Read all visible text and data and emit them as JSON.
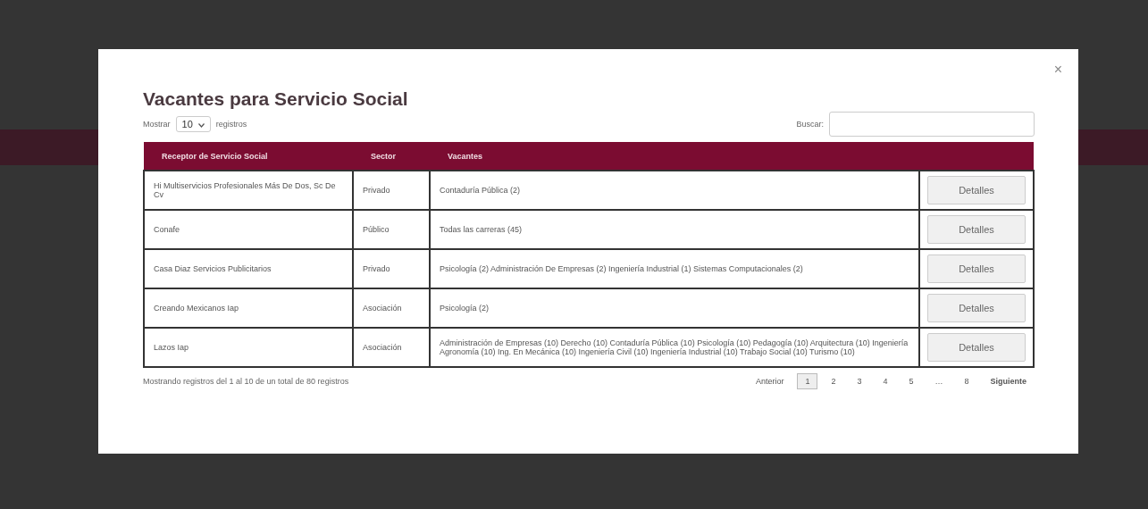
{
  "modal": {
    "title": "Vacantes para Servicio Social",
    "close": "×",
    "length": {
      "prefix": "Mostrar",
      "value": "10",
      "suffix": "registros"
    },
    "search": {
      "label": "Buscar:"
    },
    "table": {
      "columns": [
        "Receptor de Servicio Social",
        "Sector",
        "Vacantes"
      ],
      "rows": [
        {
          "receptor": "Hi Multiservicios Profesionales Más De Dos, Sc De Cv",
          "sector": "Privado",
          "vacantes": "Contaduría Pública (2)",
          "action": "Detalles"
        },
        {
          "receptor": "Conafe",
          "sector": "Público",
          "vacantes": "Todas las carreras (45)",
          "action": "Detalles"
        },
        {
          "receptor": "Casa Diaz Servicios Publicitarios",
          "sector": "Privado",
          "vacantes": "Psicología (2) Administración De Empresas (2) Ingeniería Industrial (1) Sistemas Computacionales (2)",
          "action": "Detalles"
        },
        {
          "receptor": "Creando Mexicanos Iap",
          "sector": "Asociación",
          "vacantes": "Psicología (2)",
          "action": "Detalles"
        },
        {
          "receptor": "Lazos Iap",
          "sector": "Asociación",
          "vacantes": "Administración de Empresas (10) Derecho (10) Contaduría Pública (10) Psicología (10) Pedagogía (10) Arquitectura (10) Ingeniería Agronomía (10) Ing. En Mecánica (10) Ingeniería Civil (10) Ingeniería Industrial (10) Trabajo Social (10) Turismo (10)",
          "action": "Detalles"
        }
      ]
    },
    "info": "Mostrando registros del 1 al 10 de un total de 80 registros",
    "pagination": {
      "previous": "Anterior",
      "pages": [
        {
          "label": "1",
          "selected": true
        },
        {
          "label": "2",
          "selected": false
        },
        {
          "label": "3",
          "selected": false
        },
        {
          "label": "4",
          "selected": false
        },
        {
          "label": "5",
          "selected": false
        },
        {
          "label": "…",
          "selected": false
        },
        {
          "label": "8",
          "selected": false
        }
      ],
      "next": "Siguiente"
    }
  }
}
